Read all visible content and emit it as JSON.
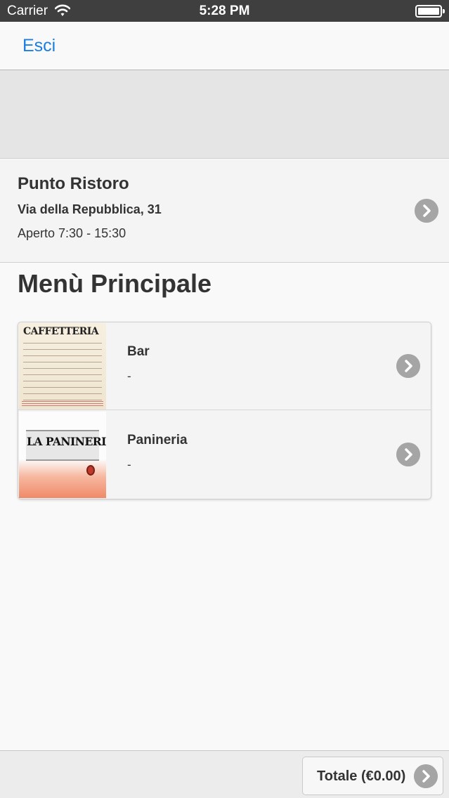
{
  "status_bar": {
    "carrier": "Carrier",
    "time": "5:28 PM"
  },
  "nav": {
    "exit_label": "Esci"
  },
  "store": {
    "name": "Punto Ristoro",
    "address": "Via della Repubblica, 31",
    "hours": "Aperto 7:30 - 15:30"
  },
  "menu": {
    "title": "Menù Principale",
    "items": [
      {
        "title": "Bar",
        "subtitle": "-",
        "image_text": "CAFFETTERIA"
      },
      {
        "title": "Panineria",
        "subtitle": "-",
        "image_text": "LA PANINERIA"
      }
    ]
  },
  "footer": {
    "total_label": "Totale (€0.00)"
  },
  "colors": {
    "accent": "#1a7ee0",
    "status_bar": "#3f3f3f",
    "chevron": "#a5a5a5"
  }
}
